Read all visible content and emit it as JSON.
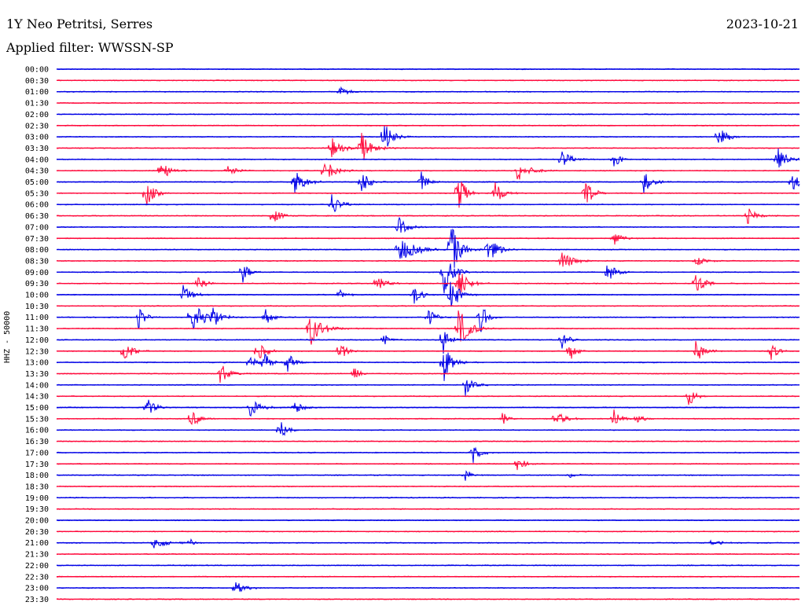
{
  "header": {
    "station": "1Y Neo Petritsi, Serres",
    "date": "2023-10-21",
    "filter_label": "Applied filter: WWSSN-SP"
  },
  "colors": {
    "trace_a": "#0000e6",
    "trace_b": "#ff0a3c",
    "text": "#000000",
    "background": "#ffffff"
  },
  "chart_data": {
    "type": "line",
    "title": "1Y Neo Petritsi, Serres",
    "subtitle": "Applied filter: WWSSN-SP",
    "date": "2023-10-21",
    "ylabel": "HHZ - 50000",
    "xlabel": "",
    "grid": false,
    "legend": "none",
    "rows": [
      "00:00",
      "00:30",
      "01:00",
      "01:30",
      "02:00",
      "02:30",
      "03:00",
      "03:30",
      "04:00",
      "04:30",
      "05:00",
      "05:30",
      "06:00",
      "06:30",
      "07:00",
      "07:30",
      "08:00",
      "08:30",
      "09:00",
      "09:30",
      "10:00",
      "10:30",
      "11:00",
      "11:30",
      "12:00",
      "12:30",
      "13:00",
      "13:30",
      "14:00",
      "14:30",
      "15:00",
      "15:30",
      "16:00",
      "16:30",
      "17:00",
      "17:30",
      "18:00",
      "18:30",
      "19:00",
      "19:30",
      "20:00",
      "20:30",
      "21:00",
      "21:30",
      "22:00",
      "22:30",
      "23:00",
      "23:30"
    ],
    "row_colors": [
      "trace_a",
      "trace_b"
    ],
    "events": [
      {
        "row": "01:00",
        "t": 0.38,
        "amp": 0.6,
        "w": 0.012
      },
      {
        "row": "03:00",
        "t": 0.44,
        "amp": 2.2,
        "w": 0.01
      },
      {
        "row": "03:00",
        "t": 0.89,
        "amp": 1.6,
        "w": 0.01
      },
      {
        "row": "03:30",
        "t": 0.37,
        "amp": 1.4,
        "w": 0.012
      },
      {
        "row": "03:30",
        "t": 0.41,
        "amp": 2.0,
        "w": 0.012
      },
      {
        "row": "04:00",
        "t": 0.68,
        "amp": 1.4,
        "w": 0.01
      },
      {
        "row": "04:00",
        "t": 0.75,
        "amp": 1.2,
        "w": 0.008
      },
      {
        "row": "04:00",
        "t": 0.97,
        "amp": 1.8,
        "w": 0.01
      },
      {
        "row": "04:30",
        "t": 0.14,
        "amp": 1.6,
        "w": 0.01
      },
      {
        "row": "04:30",
        "t": 0.23,
        "amp": 0.9,
        "w": 0.01
      },
      {
        "row": "04:30",
        "t": 0.36,
        "amp": 1.5,
        "w": 0.012
      },
      {
        "row": "04:30",
        "t": 0.62,
        "amp": 1.4,
        "w": 0.014
      },
      {
        "row": "05:00",
        "t": 0.32,
        "amp": 1.8,
        "w": 0.012
      },
      {
        "row": "05:00",
        "t": 0.41,
        "amp": 1.6,
        "w": 0.01
      },
      {
        "row": "05:00",
        "t": 0.49,
        "amp": 1.4,
        "w": 0.01
      },
      {
        "row": "05:00",
        "t": 0.79,
        "amp": 1.6,
        "w": 0.01
      },
      {
        "row": "05:00",
        "t": 0.99,
        "amp": 1.4,
        "w": 0.012
      },
      {
        "row": "05:30",
        "t": 0.12,
        "amp": 1.8,
        "w": 0.01
      },
      {
        "row": "05:30",
        "t": 0.54,
        "amp": 3.0,
        "w": 0.008
      },
      {
        "row": "05:30",
        "t": 0.59,
        "amp": 1.6,
        "w": 0.01
      },
      {
        "row": "05:30",
        "t": 0.71,
        "amp": 2.0,
        "w": 0.01
      },
      {
        "row": "06:00",
        "t": 0.37,
        "amp": 1.6,
        "w": 0.01
      },
      {
        "row": "06:30",
        "t": 0.29,
        "amp": 1.6,
        "w": 0.008
      },
      {
        "row": "06:30",
        "t": 0.93,
        "amp": 1.2,
        "w": 0.01
      },
      {
        "row": "07:00",
        "t": 0.46,
        "amp": 1.4,
        "w": 0.01
      },
      {
        "row": "07:30",
        "t": 0.75,
        "amp": 0.9,
        "w": 0.01
      },
      {
        "row": "08:00",
        "t": 0.46,
        "amp": 1.8,
        "w": 0.02
      },
      {
        "row": "08:00",
        "t": 0.53,
        "amp": 4.0,
        "w": 0.01
      },
      {
        "row": "08:00",
        "t": 0.58,
        "amp": 2.6,
        "w": 0.01
      },
      {
        "row": "08:30",
        "t": 0.68,
        "amp": 1.6,
        "w": 0.012
      },
      {
        "row": "08:30",
        "t": 0.86,
        "amp": 0.9,
        "w": 0.01
      },
      {
        "row": "09:00",
        "t": 0.25,
        "amp": 1.6,
        "w": 0.008
      },
      {
        "row": "09:00",
        "t": 0.52,
        "amp": 3.4,
        "w": 0.01
      },
      {
        "row": "09:00",
        "t": 0.74,
        "amp": 1.6,
        "w": 0.01
      },
      {
        "row": "09:30",
        "t": 0.19,
        "amp": 1.2,
        "w": 0.01
      },
      {
        "row": "09:30",
        "t": 0.43,
        "amp": 1.4,
        "w": 0.01
      },
      {
        "row": "09:30",
        "t": 0.54,
        "amp": 2.6,
        "w": 0.01
      },
      {
        "row": "09:30",
        "t": 0.86,
        "amp": 1.6,
        "w": 0.01
      },
      {
        "row": "10:00",
        "t": 0.17,
        "amp": 1.4,
        "w": 0.01
      },
      {
        "row": "10:00",
        "t": 0.38,
        "amp": 0.8,
        "w": 0.008
      },
      {
        "row": "10:00",
        "t": 0.48,
        "amp": 1.4,
        "w": 0.01
      },
      {
        "row": "10:00",
        "t": 0.53,
        "amp": 2.4,
        "w": 0.01
      },
      {
        "row": "11:00",
        "t": 0.11,
        "amp": 1.6,
        "w": 0.008
      },
      {
        "row": "11:00",
        "t": 0.18,
        "amp": 2.2,
        "w": 0.016
      },
      {
        "row": "11:00",
        "t": 0.21,
        "amp": 1.8,
        "w": 0.01
      },
      {
        "row": "11:00",
        "t": 0.28,
        "amp": 1.2,
        "w": 0.01
      },
      {
        "row": "11:00",
        "t": 0.5,
        "amp": 1.2,
        "w": 0.01
      },
      {
        "row": "11:00",
        "t": 0.57,
        "amp": 2.4,
        "w": 0.008
      },
      {
        "row": "11:30",
        "t": 0.34,
        "amp": 2.6,
        "w": 0.014
      },
      {
        "row": "11:30",
        "t": 0.54,
        "amp": 3.2,
        "w": 0.012
      },
      {
        "row": "12:00",
        "t": 0.44,
        "amp": 0.9,
        "w": 0.006
      },
      {
        "row": "12:00",
        "t": 0.52,
        "amp": 2.4,
        "w": 0.008
      },
      {
        "row": "12:00",
        "t": 0.68,
        "amp": 1.2,
        "w": 0.008
      },
      {
        "row": "12:30",
        "t": 0.09,
        "amp": 1.6,
        "w": 0.01
      },
      {
        "row": "12:30",
        "t": 0.27,
        "amp": 1.4,
        "w": 0.01
      },
      {
        "row": "12:30",
        "t": 0.38,
        "amp": 1.6,
        "w": 0.008
      },
      {
        "row": "12:30",
        "t": 0.69,
        "amp": 1.6,
        "w": 0.008
      },
      {
        "row": "12:30",
        "t": 0.86,
        "amp": 1.6,
        "w": 0.01
      },
      {
        "row": "12:30",
        "t": 0.96,
        "amp": 1.6,
        "w": 0.008
      },
      {
        "row": "13:00",
        "t": 0.26,
        "amp": 1.2,
        "w": 0.008
      },
      {
        "row": "13:00",
        "t": 0.28,
        "amp": 1.4,
        "w": 0.008
      },
      {
        "row": "13:00",
        "t": 0.31,
        "amp": 1.6,
        "w": 0.008
      },
      {
        "row": "13:00",
        "t": 0.52,
        "amp": 2.8,
        "w": 0.01
      },
      {
        "row": "13:30",
        "t": 0.22,
        "amp": 1.6,
        "w": 0.01
      },
      {
        "row": "13:30",
        "t": 0.4,
        "amp": 1.0,
        "w": 0.008
      },
      {
        "row": "14:00",
        "t": 0.55,
        "amp": 1.4,
        "w": 0.01
      },
      {
        "row": "14:30",
        "t": 0.85,
        "amp": 1.6,
        "w": 0.008
      },
      {
        "row": "15:00",
        "t": 0.12,
        "amp": 1.4,
        "w": 0.01
      },
      {
        "row": "15:00",
        "t": 0.26,
        "amp": 1.4,
        "w": 0.012
      },
      {
        "row": "15:00",
        "t": 0.32,
        "amp": 1.4,
        "w": 0.008
      },
      {
        "row": "15:30",
        "t": 0.18,
        "amp": 1.4,
        "w": 0.01
      },
      {
        "row": "15:30",
        "t": 0.6,
        "amp": 1.2,
        "w": 0.006
      },
      {
        "row": "15:30",
        "t": 0.67,
        "amp": 1.6,
        "w": 0.01
      },
      {
        "row": "15:30",
        "t": 0.75,
        "amp": 1.4,
        "w": 0.008
      },
      {
        "row": "15:30",
        "t": 0.78,
        "amp": 0.8,
        "w": 0.008
      },
      {
        "row": "16:00",
        "t": 0.3,
        "amp": 1.4,
        "w": 0.01
      },
      {
        "row": "17:00",
        "t": 0.56,
        "amp": 1.8,
        "w": 0.008
      },
      {
        "row": "17:30",
        "t": 0.62,
        "amp": 1.2,
        "w": 0.008
      },
      {
        "row": "18:00",
        "t": 0.55,
        "amp": 1.0,
        "w": 0.006
      },
      {
        "row": "18:00",
        "t": 0.69,
        "amp": 0.4,
        "w": 0.01
      },
      {
        "row": "21:00",
        "t": 0.13,
        "amp": 0.7,
        "w": 0.02
      },
      {
        "row": "21:00",
        "t": 0.18,
        "amp": 0.7,
        "w": 0.004
      },
      {
        "row": "21:00",
        "t": 0.88,
        "amp": 0.3,
        "w": 0.02
      },
      {
        "row": "23:00",
        "t": 0.24,
        "amp": 1.2,
        "w": 0.01
      }
    ]
  }
}
